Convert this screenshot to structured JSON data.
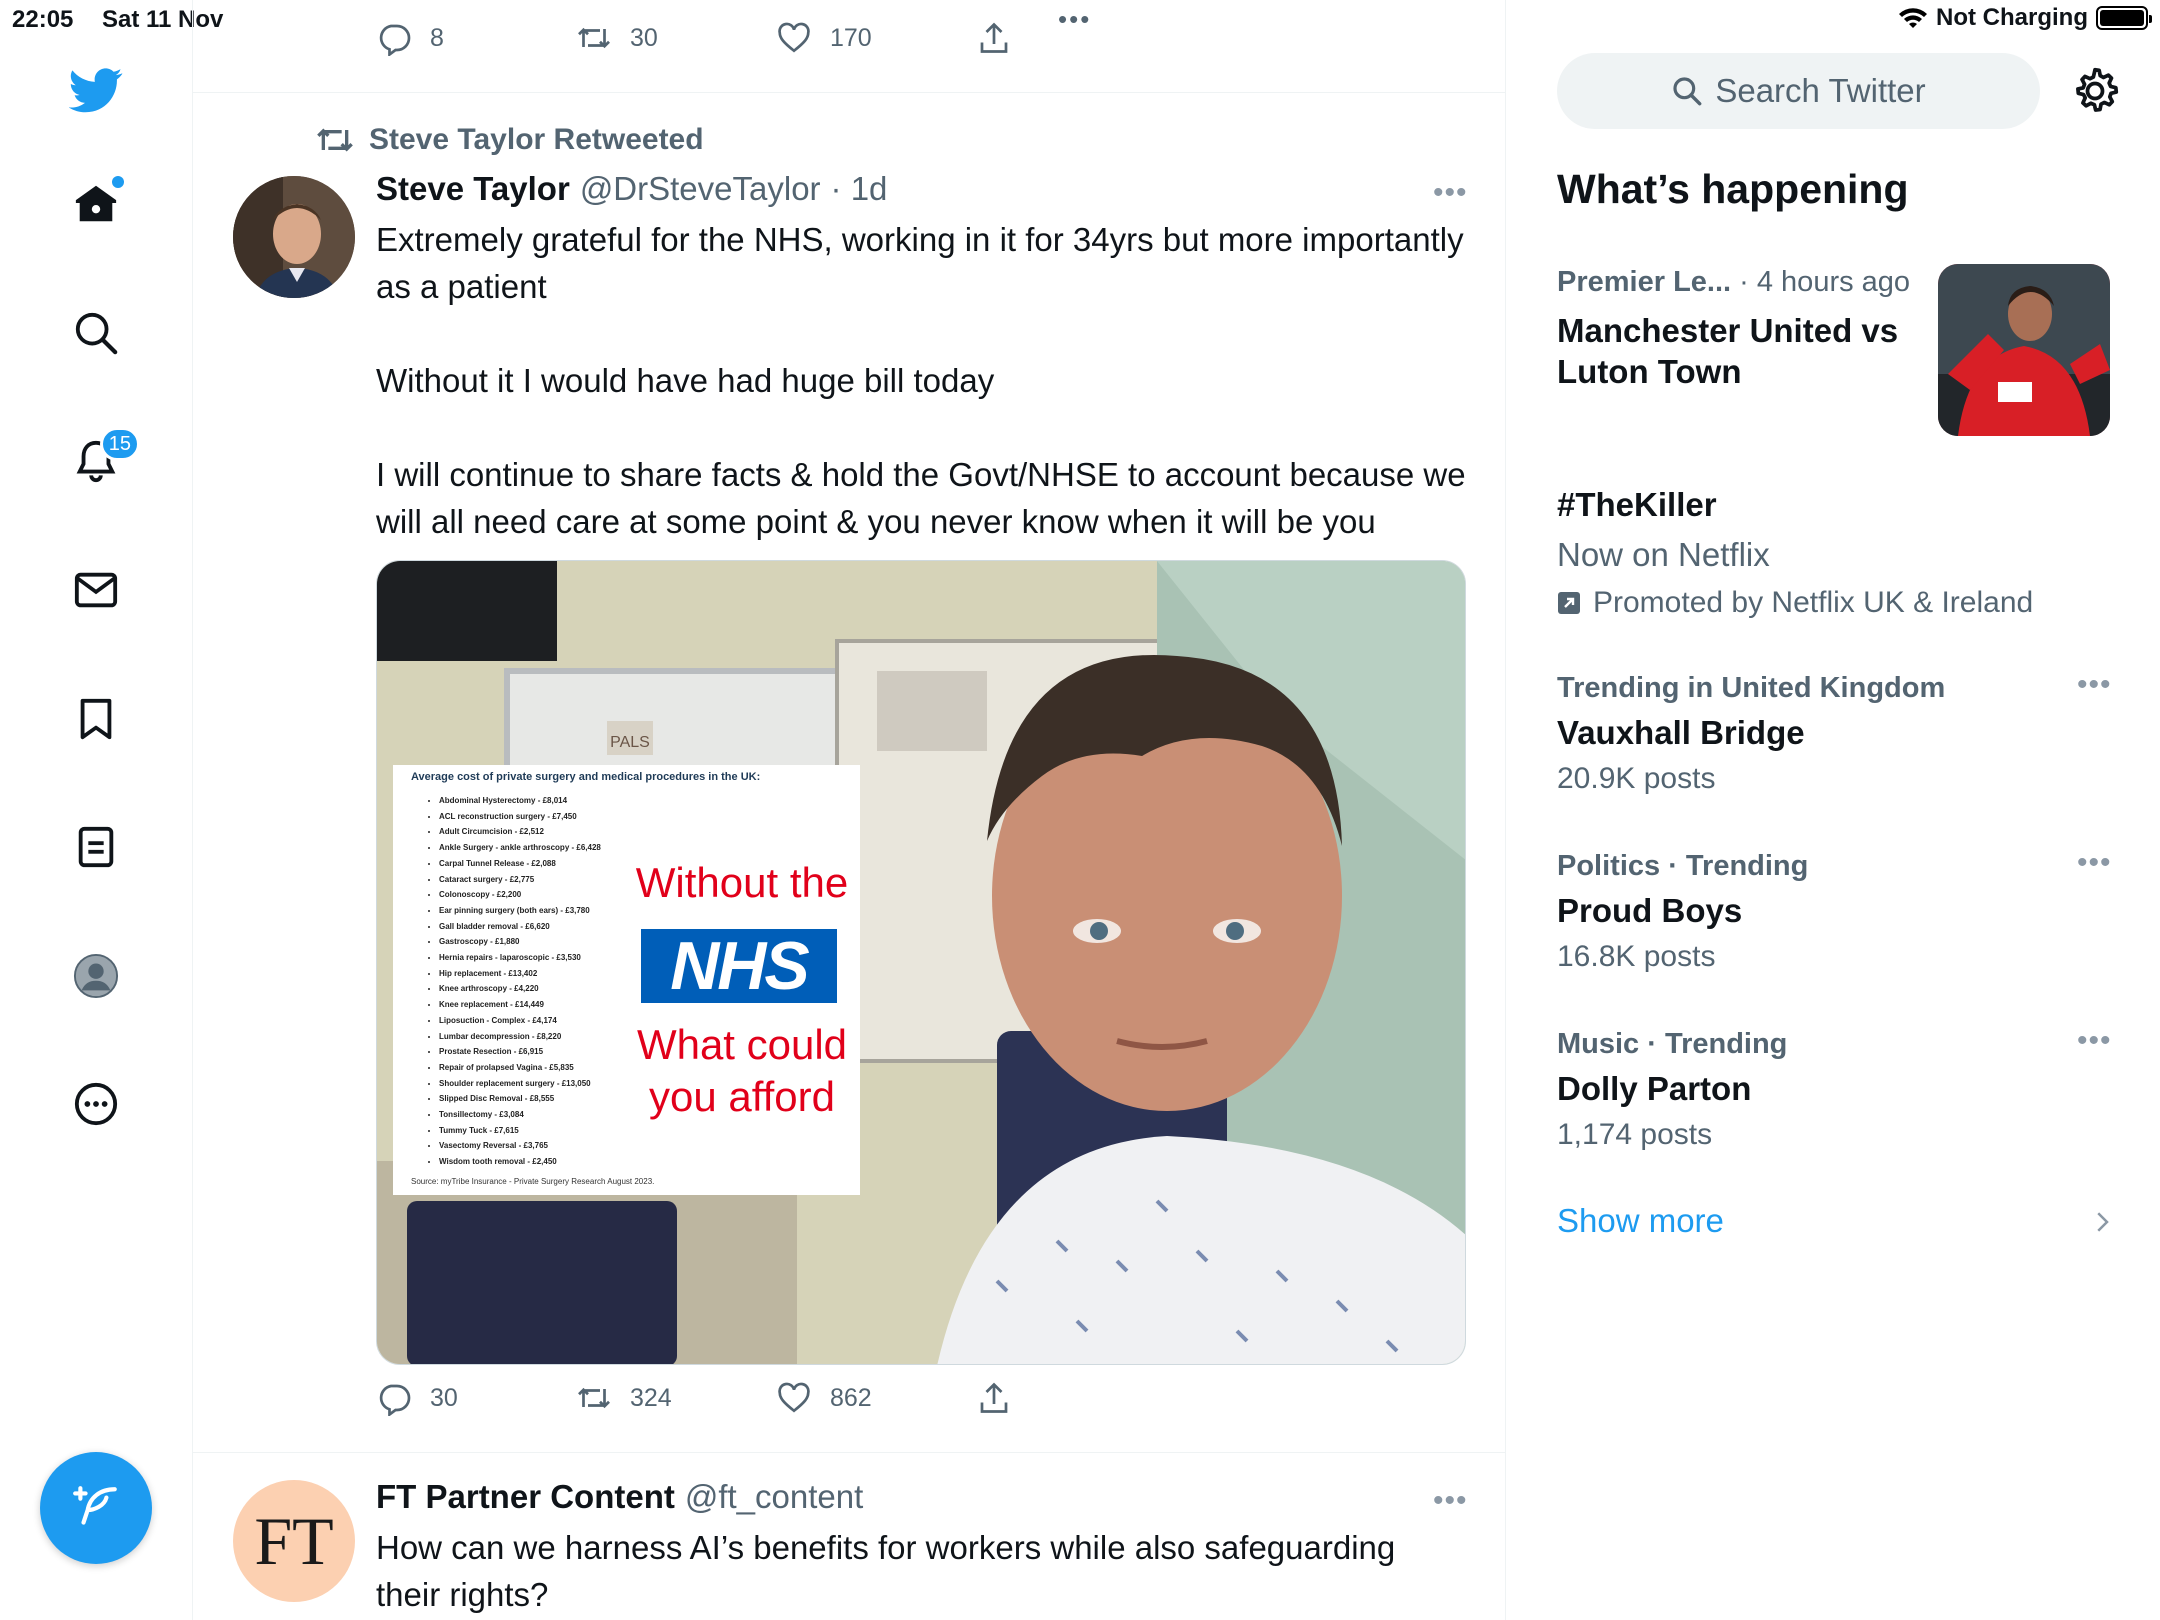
{
  "status_bar": {
    "time": "22:05",
    "date": "Sat 11 Nov",
    "charging": "Not Charging"
  },
  "nav": {
    "notifications_count": "15",
    "accent_color": "#1d9bf0"
  },
  "previous_tweet": {
    "replies": "8",
    "retweets": "30",
    "likes": "170"
  },
  "tweet": {
    "retweeted_by": "Steve Taylor Retweeted",
    "name": "Steve Taylor",
    "handle": "@DrSteveTaylor",
    "time": "· 1d",
    "text": "Extremely grateful for the NHS, working in it for 34yrs but more importantly as a patient\n\nWithout it I would have had huge bill today\n\nI will continue to share facts & hold the Govt/NHSE to account because we will all need care at some point & you never know when it will be you",
    "media": {
      "pals_sign": "PALS",
      "overlay_title": "Average cost of private surgery and medical procedures in the UK:",
      "procedures": [
        "Abdominal Hysterectomy - £8,014",
        "ACL reconstruction surgery - £7,450",
        "Adult Circumcision - £2,512",
        "Ankle Surgery - ankle arthroscopy - £6,428",
        "Carpal Tunnel Release - £2,088",
        "Cataract surgery - £2,775",
        "Colonoscopy - £2,200",
        "Ear pinning surgery (both ears) - £3,780",
        "Gall bladder removal - £6,620",
        "Gastroscopy - £1,880",
        "Hernia repairs - laparoscopic - £3,530",
        "Hip replacement - £13,402",
        "Knee arthroscopy - £4,220",
        "Knee replacement - £14,449",
        "Liposuction - Complex - £4,174",
        "Lumbar decompression - £8,220",
        "Prostate Resection - £6,915",
        "Repair of prolapsed Vagina - £5,835",
        "Shoulder replacement surgery - £13,050",
        "Slipped Disc Removal - £8,555",
        "Tonsillectomy - £3,084",
        "Tummy Tuck - £7,615",
        "Vasectomy Reversal - £3,765",
        "Wisdom tooth removal - £2,450"
      ],
      "source": "Source: myTribe Insurance - Private Surgery Research August 2023.",
      "without_the": "Without the",
      "nhs": "NHS",
      "what_could": "What could you afford"
    },
    "replies": "30",
    "retweets": "324",
    "likes": "862"
  },
  "ft_tweet": {
    "avatar_text": "FT",
    "name": "FT Partner Content",
    "handle": "@ft_content",
    "text": "How can we harness AI’s benefits for workers while also safeguarding their rights?"
  },
  "sidebar": {
    "search_placeholder": "Search Twitter",
    "section_title": "What’s happening",
    "trends": [
      {
        "meta": "Premier Le...",
        "meta2": "· 4 hours ago",
        "title": "Manchester United vs Luton Town"
      },
      {
        "title": "#TheKiller",
        "sub": "Now on Netflix",
        "promoted": "Promoted by Netflix UK & Ireland"
      },
      {
        "meta": "Trending in United Kingdom",
        "title": "Vauxhall Bridge",
        "sub": "20.9K posts"
      },
      {
        "meta": "Politics · Trending",
        "title": "Proud Boys",
        "sub": "16.8K posts"
      },
      {
        "meta": "Music · Trending",
        "title": "Dolly Parton",
        "sub": "1,174 posts"
      }
    ],
    "show_more": "Show more"
  }
}
